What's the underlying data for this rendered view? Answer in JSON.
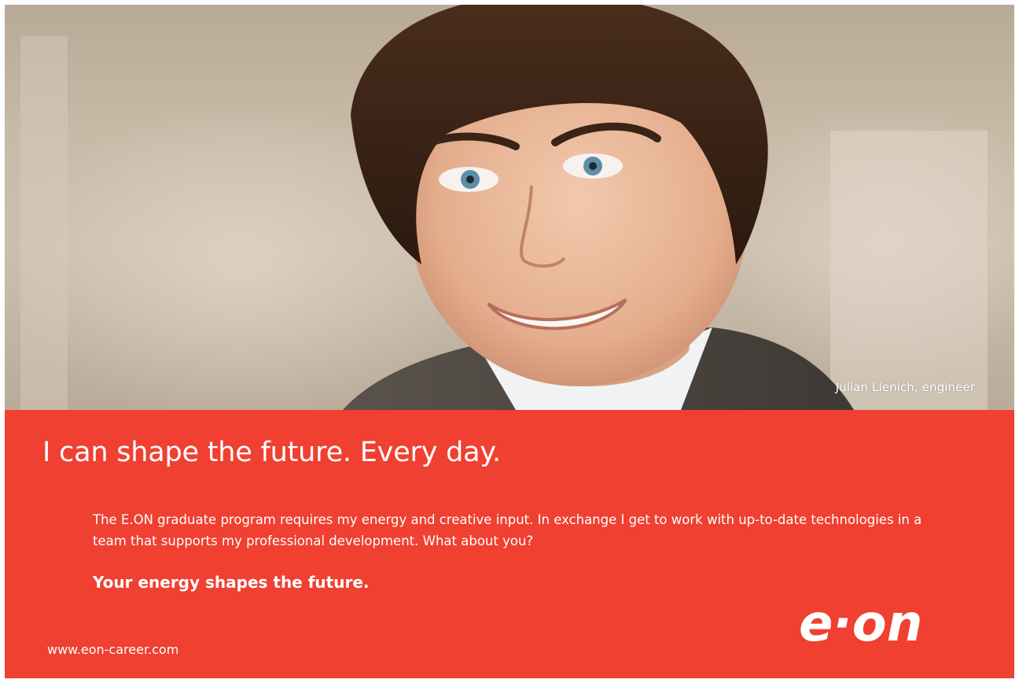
{
  "photo": {
    "caption": "Julian Lienich, engineer"
  },
  "ad": {
    "headline": "I can shape the future. Every day.",
    "body": "The E.ON graduate program requires my energy and creative input. In exchange I get to work with up-to-date technologies in a team that supports my professional development. What about you?",
    "tagline": "Your energy shapes the future.",
    "url": "www.eon-career.com"
  },
  "logo": {
    "text": "e·on"
  },
  "colors": {
    "brand_red": "#ef4031",
    "text": "#ffffff"
  }
}
